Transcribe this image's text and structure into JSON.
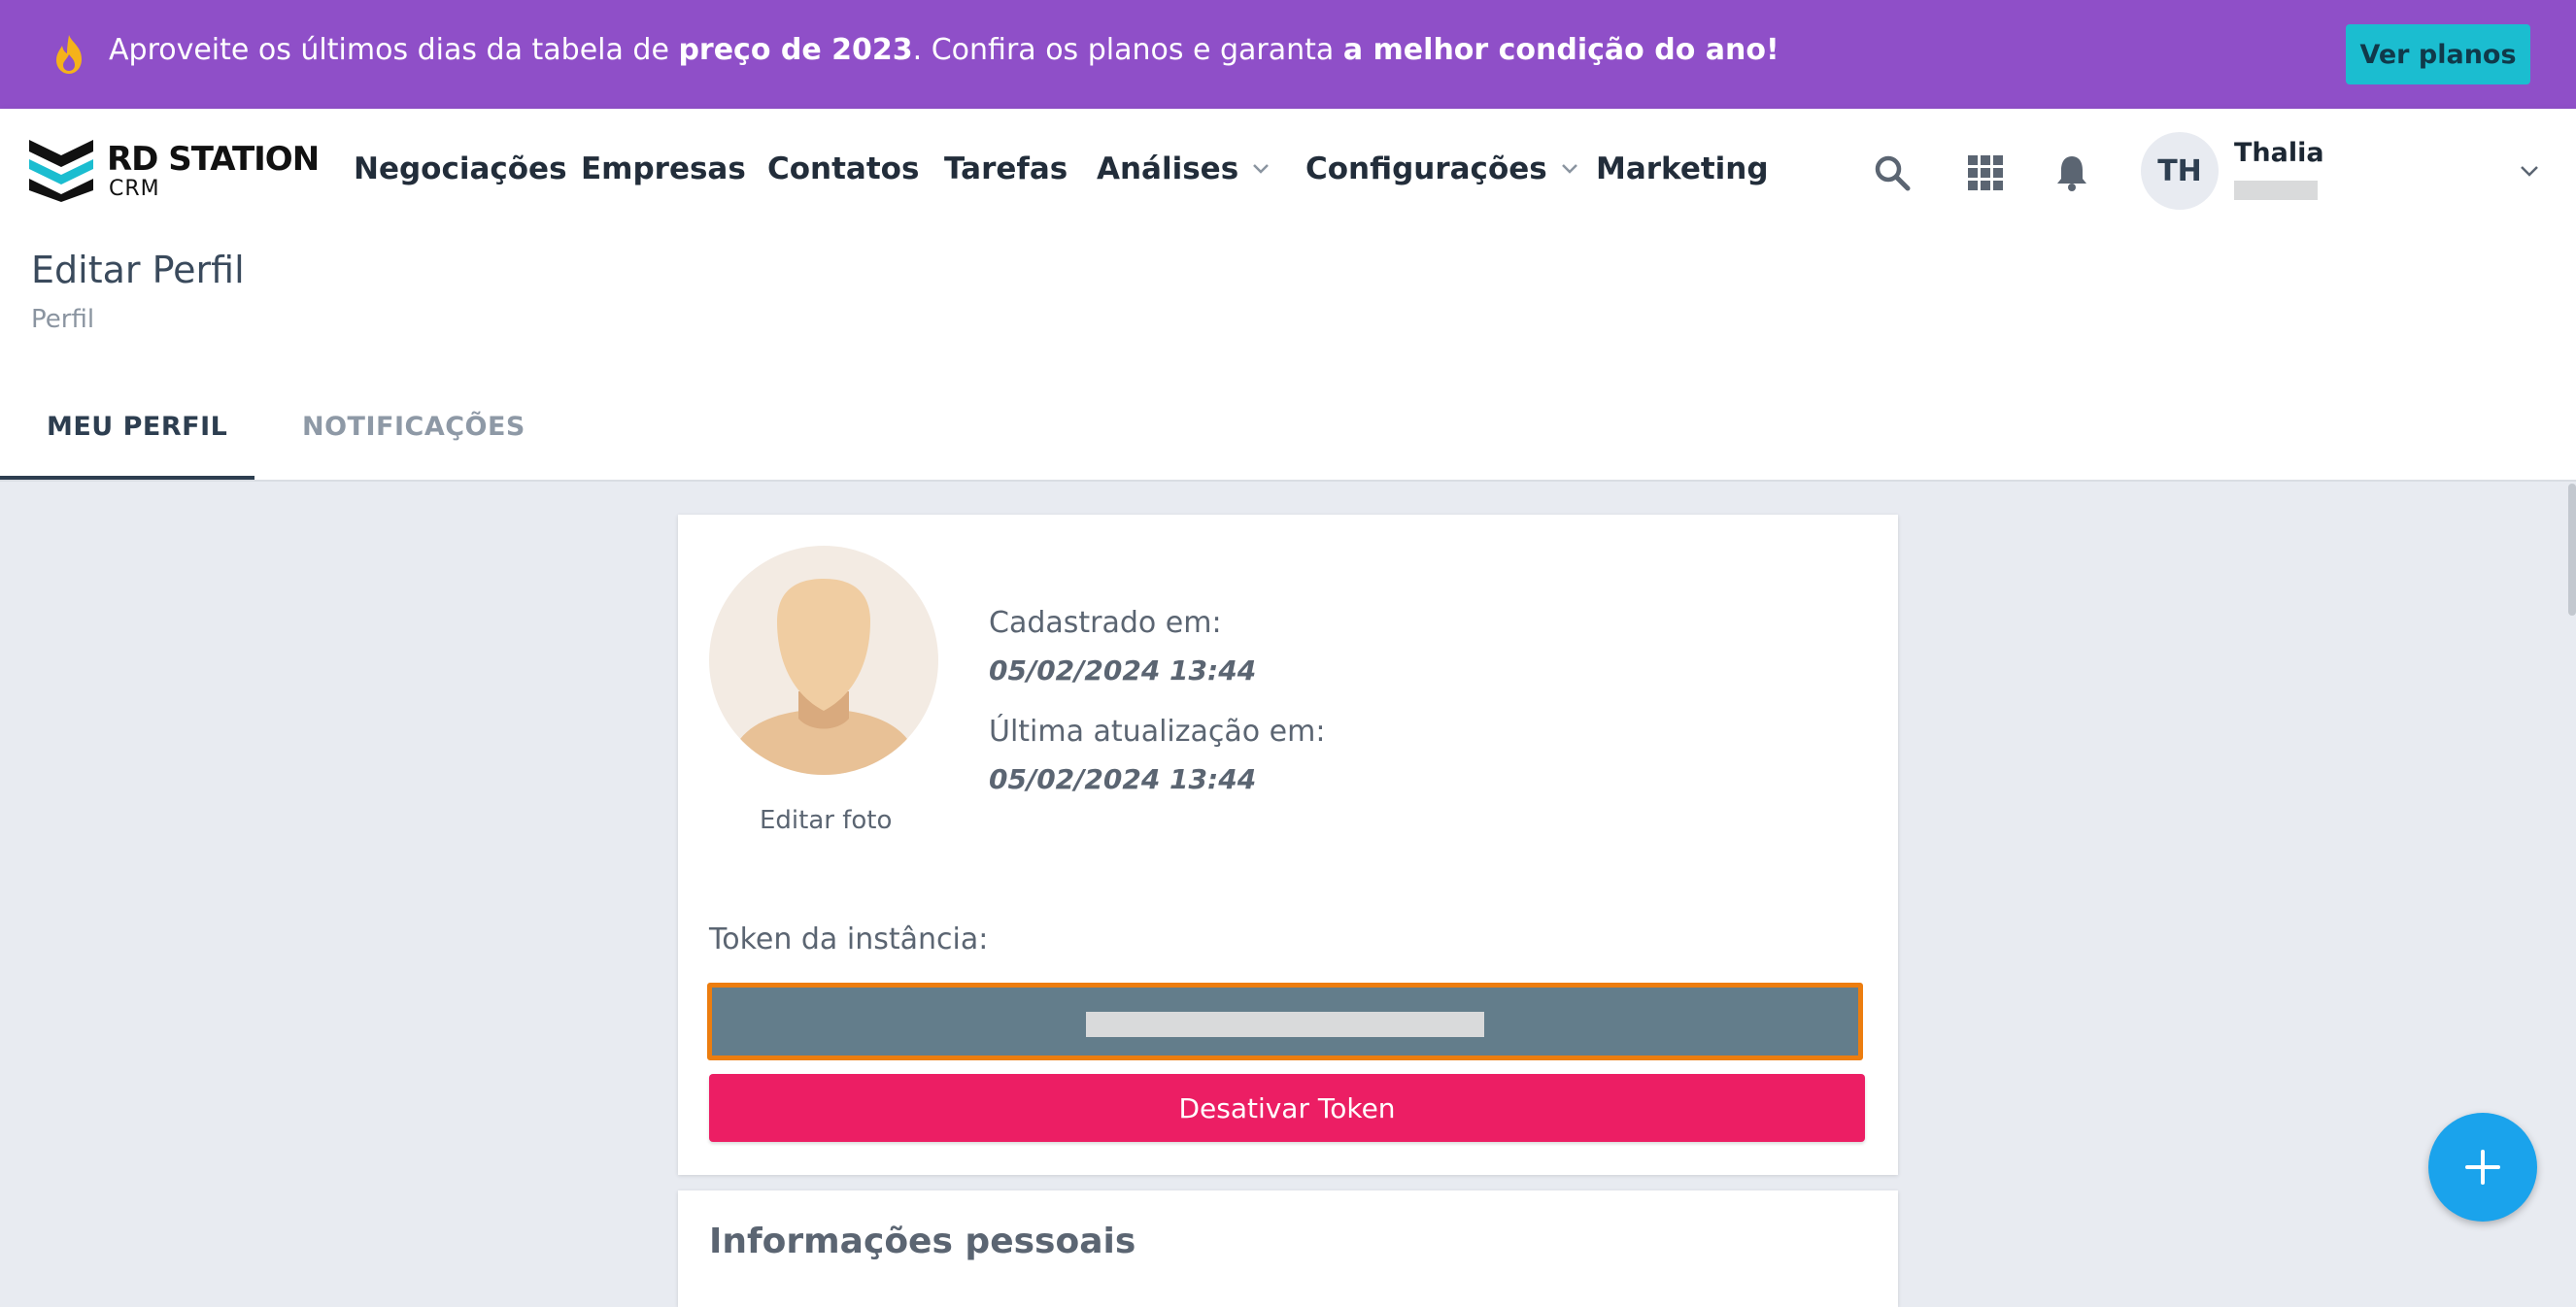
{
  "promo": {
    "text_part1": "Aproveite os últimos dias da tabela de ",
    "text_bold1": "preço de 2023",
    "text_part2": ". Confira os planos e garanta ",
    "text_bold2": "a melhor condição do ano!",
    "cta_label": "Ver planos",
    "icon": "fire-icon"
  },
  "logo": {
    "brand": "RD STATION",
    "sub": "CRM"
  },
  "nav": {
    "items": [
      {
        "label": "Negociações"
      },
      {
        "label": "Empresas"
      },
      {
        "label": "Contatos"
      },
      {
        "label": "Tarefas"
      },
      {
        "label": "Análises",
        "dropdown": true
      },
      {
        "label": "Configurações",
        "dropdown": true
      },
      {
        "label": "Marketing"
      }
    ],
    "icons": [
      "search-icon",
      "apps-grid-icon",
      "bell-icon"
    ]
  },
  "user": {
    "initials": "TH",
    "name": "Thalia"
  },
  "page": {
    "title": "Editar Perfil",
    "breadcrumb": "Perfil",
    "tabs": [
      {
        "label": "MEU PERFIL",
        "active": true
      },
      {
        "label": "NOTIFICAÇÕES",
        "active": false
      }
    ]
  },
  "profile": {
    "edit_photo": "Editar foto",
    "created_label": "Cadastrado em:",
    "created_value": "05/02/2024 13:44",
    "updated_label": "Última atualização em:",
    "updated_value": "05/02/2024 13:44",
    "token_label": "Token da instância:",
    "deactivate_label": "Desativar Token"
  },
  "personal": {
    "title": "Informações pessoais"
  },
  "colors": {
    "promo_bg": "#8f4fc8",
    "cta_bg": "#1bbdd0",
    "danger": "#ec1e64",
    "fab": "#1aa3ec",
    "token_bg": "#637d8b",
    "token_border": "#ec7d0f"
  }
}
